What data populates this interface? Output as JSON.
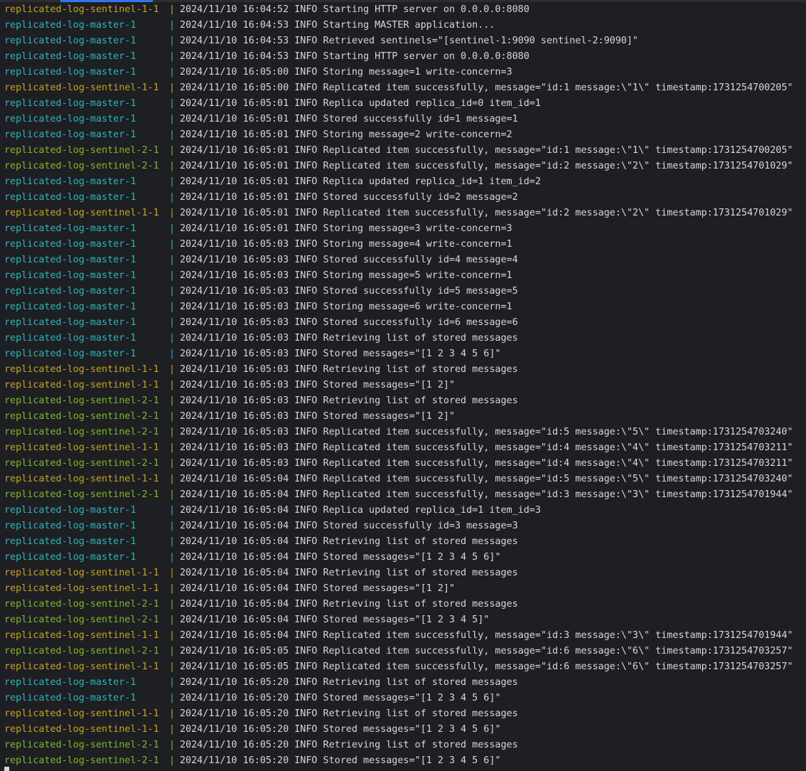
{
  "colors": {
    "background": "#1e1f22",
    "text": "#d5d8dc",
    "master": "#2fb5bc",
    "sentinel_1": "#c9a227",
    "sentinel_2": "#7fb82d",
    "accent": "#3574f0"
  },
  "separator": "|",
  "lines": [
    {
      "service": "replicated-log-sentinel-1-1",
      "kind": "sentinel-1",
      "message": "2024/11/10 16:04:52 INFO Starting HTTP server on 0.0.0.0:8080"
    },
    {
      "service": "replicated-log-master-1",
      "kind": "master",
      "message": "2024/11/10 16:04:53 INFO Starting MASTER application..."
    },
    {
      "service": "replicated-log-master-1",
      "kind": "master",
      "message": "2024/11/10 16:04:53 INFO Retrieved sentinels=\"[sentinel-1:9090 sentinel-2:9090]\""
    },
    {
      "service": "replicated-log-master-1",
      "kind": "master",
      "message": "2024/11/10 16:04:53 INFO Starting HTTP server on 0.0.0.0:8080"
    },
    {
      "service": "replicated-log-master-1",
      "kind": "master",
      "message": "2024/11/10 16:05:00 INFO Storing message=1 write-concern=3"
    },
    {
      "service": "replicated-log-sentinel-1-1",
      "kind": "sentinel-1",
      "message": "2024/11/10 16:05:00 INFO Replicated item successfully, message=\"id:1 message:\\\"1\\\" timestamp:1731254700205\""
    },
    {
      "service": "replicated-log-master-1",
      "kind": "master",
      "message": "2024/11/10 16:05:01 INFO Replica updated replica_id=0 item_id=1"
    },
    {
      "service": "replicated-log-master-1",
      "kind": "master",
      "message": "2024/11/10 16:05:01 INFO Stored successfully id=1 message=1"
    },
    {
      "service": "replicated-log-master-1",
      "kind": "master",
      "message": "2024/11/10 16:05:01 INFO Storing message=2 write-concern=2"
    },
    {
      "service": "replicated-log-sentinel-2-1",
      "kind": "sentinel-2",
      "message": "2024/11/10 16:05:01 INFO Replicated item successfully, message=\"id:1 message:\\\"1\\\" timestamp:1731254700205\""
    },
    {
      "service": "replicated-log-sentinel-2-1",
      "kind": "sentinel-2",
      "message": "2024/11/10 16:05:01 INFO Replicated item successfully, message=\"id:2 message:\\\"2\\\" timestamp:1731254701029\""
    },
    {
      "service": "replicated-log-master-1",
      "kind": "master",
      "message": "2024/11/10 16:05:01 INFO Replica updated replica_id=1 item_id=2"
    },
    {
      "service": "replicated-log-master-1",
      "kind": "master",
      "message": "2024/11/10 16:05:01 INFO Stored successfully id=2 message=2"
    },
    {
      "service": "replicated-log-sentinel-1-1",
      "kind": "sentinel-1",
      "message": "2024/11/10 16:05:01 INFO Replicated item successfully, message=\"id:2 message:\\\"2\\\" timestamp:1731254701029\""
    },
    {
      "service": "replicated-log-master-1",
      "kind": "master",
      "message": "2024/11/10 16:05:01 INFO Storing message=3 write-concern=3"
    },
    {
      "service": "replicated-log-master-1",
      "kind": "master",
      "message": "2024/11/10 16:05:03 INFO Storing message=4 write-concern=1"
    },
    {
      "service": "replicated-log-master-1",
      "kind": "master",
      "message": "2024/11/10 16:05:03 INFO Stored successfully id=4 message=4"
    },
    {
      "service": "replicated-log-master-1",
      "kind": "master",
      "message": "2024/11/10 16:05:03 INFO Storing message=5 write-concern=1"
    },
    {
      "service": "replicated-log-master-1",
      "kind": "master",
      "message": "2024/11/10 16:05:03 INFO Stored successfully id=5 message=5"
    },
    {
      "service": "replicated-log-master-1",
      "kind": "master",
      "message": "2024/11/10 16:05:03 INFO Storing message=6 write-concern=1"
    },
    {
      "service": "replicated-log-master-1",
      "kind": "master",
      "message": "2024/11/10 16:05:03 INFO Stored successfully id=6 message=6"
    },
    {
      "service": "replicated-log-master-1",
      "kind": "master",
      "message": "2024/11/10 16:05:03 INFO Retrieving list of stored messages"
    },
    {
      "service": "replicated-log-master-1",
      "kind": "master",
      "message": "2024/11/10 16:05:03 INFO Stored messages=\"[1 2 3 4 5 6]\""
    },
    {
      "service": "replicated-log-sentinel-1-1",
      "kind": "sentinel-1",
      "message": "2024/11/10 16:05:03 INFO Retrieving list of stored messages"
    },
    {
      "service": "replicated-log-sentinel-1-1",
      "kind": "sentinel-1",
      "message": "2024/11/10 16:05:03 INFO Stored messages=\"[1 2]\""
    },
    {
      "service": "replicated-log-sentinel-2-1",
      "kind": "sentinel-2",
      "message": "2024/11/10 16:05:03 INFO Retrieving list of stored messages"
    },
    {
      "service": "replicated-log-sentinel-2-1",
      "kind": "sentinel-2",
      "message": "2024/11/10 16:05:03 INFO Stored messages=\"[1 2]\""
    },
    {
      "service": "replicated-log-sentinel-2-1",
      "kind": "sentinel-2",
      "message": "2024/11/10 16:05:03 INFO Replicated item successfully, message=\"id:5 message:\\\"5\\\" timestamp:1731254703240\""
    },
    {
      "service": "replicated-log-sentinel-1-1",
      "kind": "sentinel-1",
      "message": "2024/11/10 16:05:03 INFO Replicated item successfully, message=\"id:4 message:\\\"4\\\" timestamp:1731254703211\""
    },
    {
      "service": "replicated-log-sentinel-2-1",
      "kind": "sentinel-2",
      "message": "2024/11/10 16:05:03 INFO Replicated item successfully, message=\"id:4 message:\\\"4\\\" timestamp:1731254703211\""
    },
    {
      "service": "replicated-log-sentinel-1-1",
      "kind": "sentinel-1",
      "message": "2024/11/10 16:05:04 INFO Replicated item successfully, message=\"id:5 message:\\\"5\\\" timestamp:1731254703240\""
    },
    {
      "service": "replicated-log-sentinel-2-1",
      "kind": "sentinel-2",
      "message": "2024/11/10 16:05:04 INFO Replicated item successfully, message=\"id:3 message:\\\"3\\\" timestamp:1731254701944\""
    },
    {
      "service": "replicated-log-master-1",
      "kind": "master",
      "message": "2024/11/10 16:05:04 INFO Replica updated replica_id=1 item_id=3"
    },
    {
      "service": "replicated-log-master-1",
      "kind": "master",
      "message": "2024/11/10 16:05:04 INFO Stored successfully id=3 message=3"
    },
    {
      "service": "replicated-log-master-1",
      "kind": "master",
      "message": "2024/11/10 16:05:04 INFO Retrieving list of stored messages"
    },
    {
      "service": "replicated-log-master-1",
      "kind": "master",
      "message": "2024/11/10 16:05:04 INFO Stored messages=\"[1 2 3 4 5 6]\""
    },
    {
      "service": "replicated-log-sentinel-1-1",
      "kind": "sentinel-1",
      "message": "2024/11/10 16:05:04 INFO Retrieving list of stored messages"
    },
    {
      "service": "replicated-log-sentinel-1-1",
      "kind": "sentinel-1",
      "message": "2024/11/10 16:05:04 INFO Stored messages=\"[1 2]\""
    },
    {
      "service": "replicated-log-sentinel-2-1",
      "kind": "sentinel-2",
      "message": "2024/11/10 16:05:04 INFO Retrieving list of stored messages"
    },
    {
      "service": "replicated-log-sentinel-2-1",
      "kind": "sentinel-2",
      "message": "2024/11/10 16:05:04 INFO Stored messages=\"[1 2 3 4 5]\""
    },
    {
      "service": "replicated-log-sentinel-1-1",
      "kind": "sentinel-1",
      "message": "2024/11/10 16:05:04 INFO Replicated item successfully, message=\"id:3 message:\\\"3\\\" timestamp:1731254701944\""
    },
    {
      "service": "replicated-log-sentinel-2-1",
      "kind": "sentinel-2",
      "message": "2024/11/10 16:05:05 INFO Replicated item successfully, message=\"id:6 message:\\\"6\\\" timestamp:1731254703257\""
    },
    {
      "service": "replicated-log-sentinel-1-1",
      "kind": "sentinel-1",
      "message": "2024/11/10 16:05:05 INFO Replicated item successfully, message=\"id:6 message:\\\"6\\\" timestamp:1731254703257\""
    },
    {
      "service": "replicated-log-master-1",
      "kind": "master",
      "message": "2024/11/10 16:05:20 INFO Retrieving list of stored messages"
    },
    {
      "service": "replicated-log-master-1",
      "kind": "master",
      "message": "2024/11/10 16:05:20 INFO Stored messages=\"[1 2 3 4 5 6]\""
    },
    {
      "service": "replicated-log-sentinel-1-1",
      "kind": "sentinel-1",
      "message": "2024/11/10 16:05:20 INFO Retrieving list of stored messages"
    },
    {
      "service": "replicated-log-sentinel-1-1",
      "kind": "sentinel-1",
      "message": "2024/11/10 16:05:20 INFO Stored messages=\"[1 2 3 4 5 6]\""
    },
    {
      "service": "replicated-log-sentinel-2-1",
      "kind": "sentinel-2",
      "message": "2024/11/10 16:05:20 INFO Retrieving list of stored messages"
    },
    {
      "service": "replicated-log-sentinel-2-1",
      "kind": "sentinel-2",
      "message": "2024/11/10 16:05:20 INFO Stored messages=\"[1 2 3 4 5 6]\""
    }
  ]
}
